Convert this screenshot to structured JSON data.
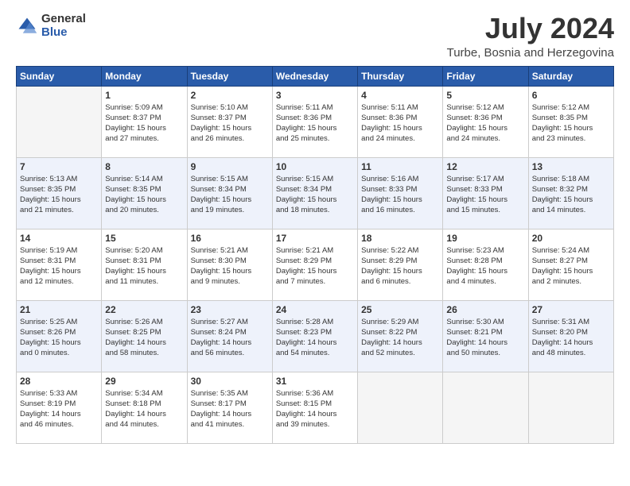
{
  "logo": {
    "general": "General",
    "blue": "Blue"
  },
  "title": "July 2024",
  "location": "Turbe, Bosnia and Herzegovina",
  "weekdays": [
    "Sunday",
    "Monday",
    "Tuesday",
    "Wednesday",
    "Thursday",
    "Friday",
    "Saturday"
  ],
  "weeks": [
    [
      {
        "day": "",
        "info": ""
      },
      {
        "day": "1",
        "info": "Sunrise: 5:09 AM\nSunset: 8:37 PM\nDaylight: 15 hours\nand 27 minutes."
      },
      {
        "day": "2",
        "info": "Sunrise: 5:10 AM\nSunset: 8:37 PM\nDaylight: 15 hours\nand 26 minutes."
      },
      {
        "day": "3",
        "info": "Sunrise: 5:11 AM\nSunset: 8:36 PM\nDaylight: 15 hours\nand 25 minutes."
      },
      {
        "day": "4",
        "info": "Sunrise: 5:11 AM\nSunset: 8:36 PM\nDaylight: 15 hours\nand 24 minutes."
      },
      {
        "day": "5",
        "info": "Sunrise: 5:12 AM\nSunset: 8:36 PM\nDaylight: 15 hours\nand 24 minutes."
      },
      {
        "day": "6",
        "info": "Sunrise: 5:12 AM\nSunset: 8:35 PM\nDaylight: 15 hours\nand 23 minutes."
      }
    ],
    [
      {
        "day": "7",
        "info": "Sunrise: 5:13 AM\nSunset: 8:35 PM\nDaylight: 15 hours\nand 21 minutes."
      },
      {
        "day": "8",
        "info": "Sunrise: 5:14 AM\nSunset: 8:35 PM\nDaylight: 15 hours\nand 20 minutes."
      },
      {
        "day": "9",
        "info": "Sunrise: 5:15 AM\nSunset: 8:34 PM\nDaylight: 15 hours\nand 19 minutes."
      },
      {
        "day": "10",
        "info": "Sunrise: 5:15 AM\nSunset: 8:34 PM\nDaylight: 15 hours\nand 18 minutes."
      },
      {
        "day": "11",
        "info": "Sunrise: 5:16 AM\nSunset: 8:33 PM\nDaylight: 15 hours\nand 16 minutes."
      },
      {
        "day": "12",
        "info": "Sunrise: 5:17 AM\nSunset: 8:33 PM\nDaylight: 15 hours\nand 15 minutes."
      },
      {
        "day": "13",
        "info": "Sunrise: 5:18 AM\nSunset: 8:32 PM\nDaylight: 15 hours\nand 14 minutes."
      }
    ],
    [
      {
        "day": "14",
        "info": "Sunrise: 5:19 AM\nSunset: 8:31 PM\nDaylight: 15 hours\nand 12 minutes."
      },
      {
        "day": "15",
        "info": "Sunrise: 5:20 AM\nSunset: 8:31 PM\nDaylight: 15 hours\nand 11 minutes."
      },
      {
        "day": "16",
        "info": "Sunrise: 5:21 AM\nSunset: 8:30 PM\nDaylight: 15 hours\nand 9 minutes."
      },
      {
        "day": "17",
        "info": "Sunrise: 5:21 AM\nSunset: 8:29 PM\nDaylight: 15 hours\nand 7 minutes."
      },
      {
        "day": "18",
        "info": "Sunrise: 5:22 AM\nSunset: 8:29 PM\nDaylight: 15 hours\nand 6 minutes."
      },
      {
        "day": "19",
        "info": "Sunrise: 5:23 AM\nSunset: 8:28 PM\nDaylight: 15 hours\nand 4 minutes."
      },
      {
        "day": "20",
        "info": "Sunrise: 5:24 AM\nSunset: 8:27 PM\nDaylight: 15 hours\nand 2 minutes."
      }
    ],
    [
      {
        "day": "21",
        "info": "Sunrise: 5:25 AM\nSunset: 8:26 PM\nDaylight: 15 hours\nand 0 minutes."
      },
      {
        "day": "22",
        "info": "Sunrise: 5:26 AM\nSunset: 8:25 PM\nDaylight: 14 hours\nand 58 minutes."
      },
      {
        "day": "23",
        "info": "Sunrise: 5:27 AM\nSunset: 8:24 PM\nDaylight: 14 hours\nand 56 minutes."
      },
      {
        "day": "24",
        "info": "Sunrise: 5:28 AM\nSunset: 8:23 PM\nDaylight: 14 hours\nand 54 minutes."
      },
      {
        "day": "25",
        "info": "Sunrise: 5:29 AM\nSunset: 8:22 PM\nDaylight: 14 hours\nand 52 minutes."
      },
      {
        "day": "26",
        "info": "Sunrise: 5:30 AM\nSunset: 8:21 PM\nDaylight: 14 hours\nand 50 minutes."
      },
      {
        "day": "27",
        "info": "Sunrise: 5:31 AM\nSunset: 8:20 PM\nDaylight: 14 hours\nand 48 minutes."
      }
    ],
    [
      {
        "day": "28",
        "info": "Sunrise: 5:33 AM\nSunset: 8:19 PM\nDaylight: 14 hours\nand 46 minutes."
      },
      {
        "day": "29",
        "info": "Sunrise: 5:34 AM\nSunset: 8:18 PM\nDaylight: 14 hours\nand 44 minutes."
      },
      {
        "day": "30",
        "info": "Sunrise: 5:35 AM\nSunset: 8:17 PM\nDaylight: 14 hours\nand 41 minutes."
      },
      {
        "day": "31",
        "info": "Sunrise: 5:36 AM\nSunset: 8:15 PM\nDaylight: 14 hours\nand 39 minutes."
      },
      {
        "day": "",
        "info": ""
      },
      {
        "day": "",
        "info": ""
      },
      {
        "day": "",
        "info": ""
      }
    ]
  ]
}
